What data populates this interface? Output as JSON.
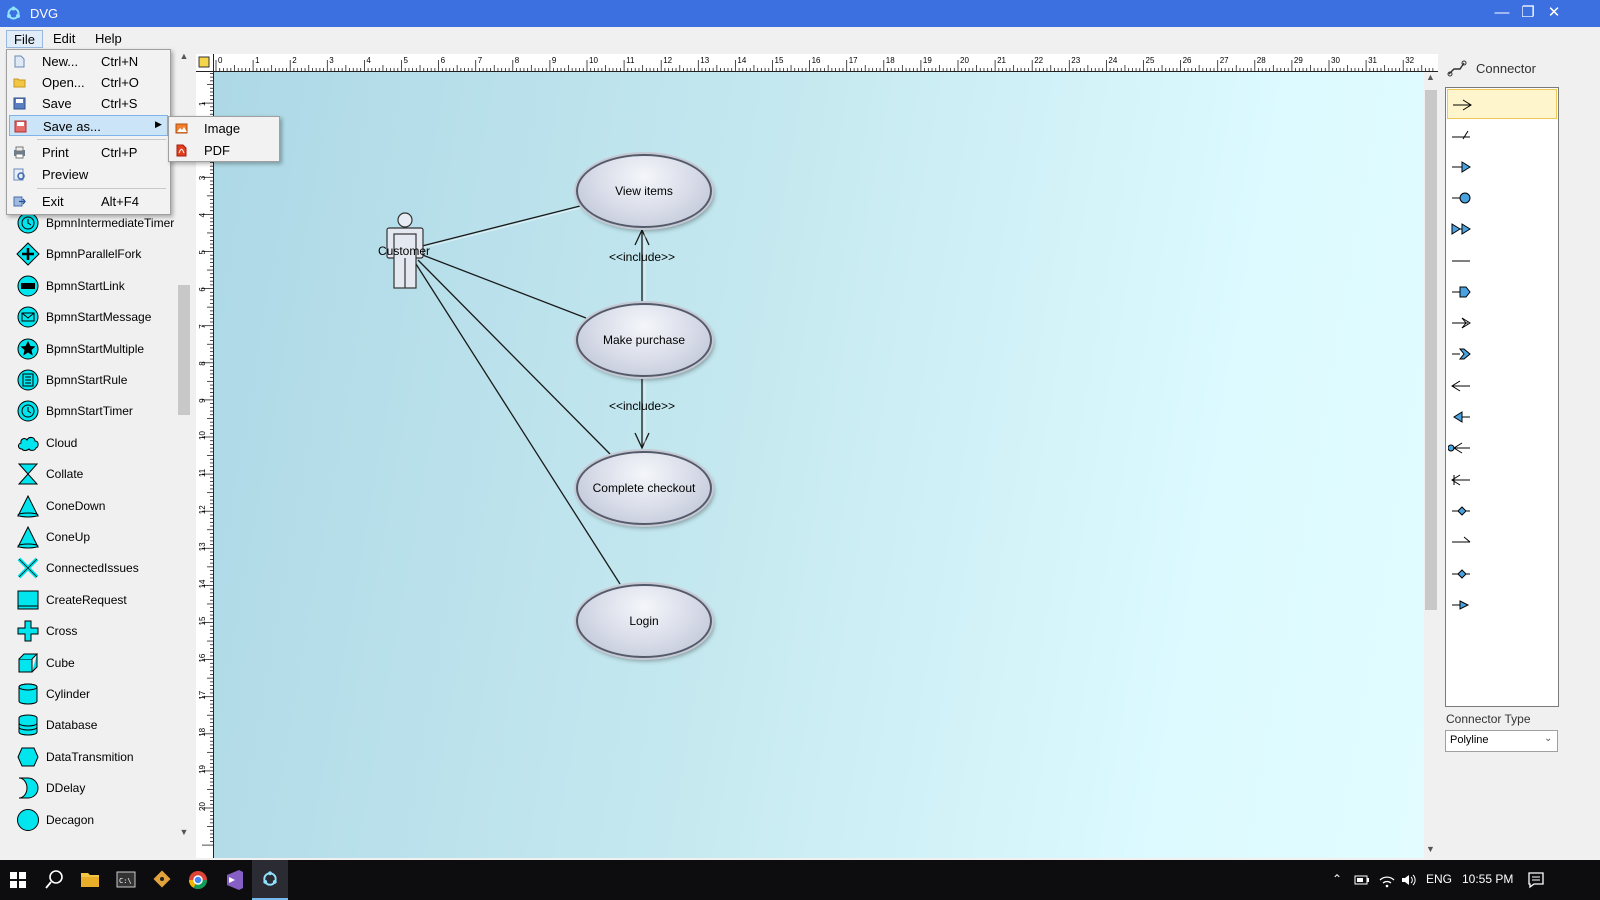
{
  "window": {
    "title": "DVG"
  },
  "menubar": {
    "items": [
      "File",
      "Edit",
      "Help"
    ]
  },
  "file_menu": {
    "items": [
      {
        "label": "New...",
        "shortcut": "Ctrl+N"
      },
      {
        "label": "Open...",
        "shortcut": "Ctrl+O"
      },
      {
        "label": "Save",
        "shortcut": "Ctrl+S"
      },
      {
        "label": "Save as...",
        "shortcut": ""
      },
      {
        "label": "Print",
        "shortcut": "Ctrl+P"
      },
      {
        "label": "Preview",
        "shortcut": ""
      },
      {
        "label": "Exit",
        "shortcut": "Alt+F4"
      }
    ]
  },
  "saveas_menu": {
    "items": [
      "Image",
      "PDF"
    ]
  },
  "shapes": [
    "BpmnIntermediateTimer",
    "BpmnParallelFork",
    "BpmnStartLink",
    "BpmnStartMessage",
    "BpmnStartMultiple",
    "BpmnStartRule",
    "BpmnStartTimer",
    "Cloud",
    "Collate",
    "ConeDown",
    "ConeUp",
    "ConnectedIssues",
    "CreateRequest",
    "Cross",
    "Cube",
    "Cylinder",
    "Database",
    "DataTransmition",
    "DDelay",
    "Decagon"
  ],
  "ruler": {
    "h_labels": [
      "0",
      "1",
      "2",
      "3",
      "4",
      "5",
      "6",
      "7",
      "8",
      "9",
      "10",
      "11",
      "12",
      "13",
      "14",
      "15",
      "16",
      "17",
      "18",
      "19",
      "20",
      "21",
      "22",
      "23",
      "24",
      "25",
      "26",
      "27",
      "28",
      "29",
      "30",
      "31",
      "32"
    ],
    "v_labels": [
      "1",
      "2",
      "3",
      "4",
      "5",
      "6",
      "7",
      "8",
      "9",
      "10",
      "11",
      "12",
      "13",
      "14",
      "15",
      "16",
      "17",
      "18",
      "19",
      "20"
    ]
  },
  "diagram": {
    "actor": "Customer",
    "usecases": [
      "View items",
      "Make purchase",
      "Complete checkout",
      "Login"
    ],
    "include_label": "<<include>>"
  },
  "right_panel": {
    "title": "Connector",
    "connector_type_label": "Connector Type",
    "connector_type_value": "Polyline"
  },
  "taskbar": {
    "lang": "ENG",
    "time": "10:55 PM"
  },
  "colors": {
    "titlebar": "#3c6fe0",
    "shape_icon": "#00e5ee",
    "canvas_start": "#add8e6",
    "canvas_end": "#e2fcff"
  }
}
